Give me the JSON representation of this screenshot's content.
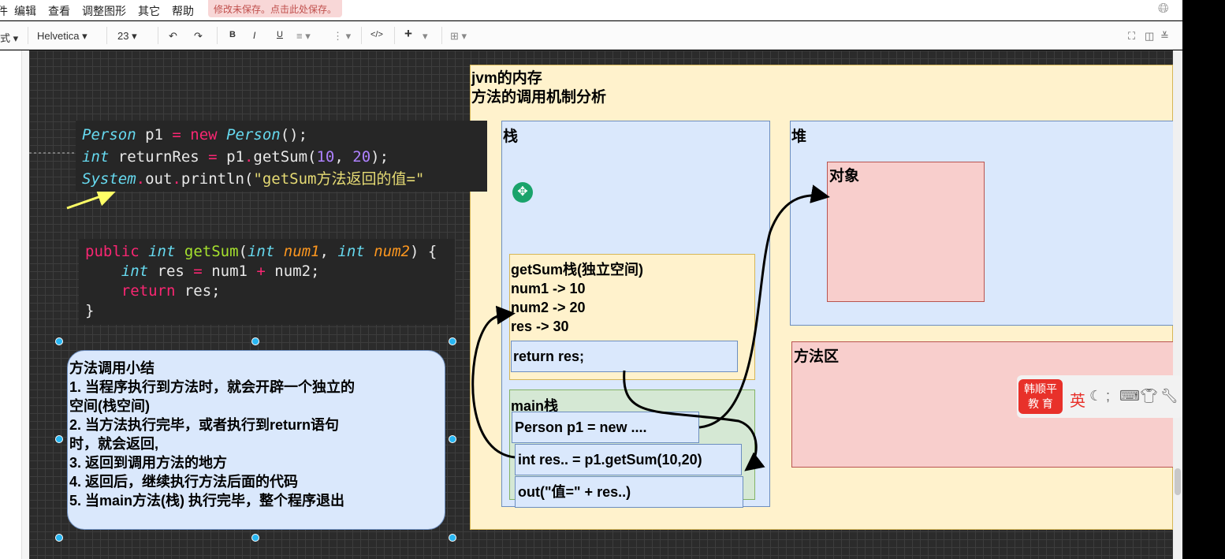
{
  "menu": [
    "编辑",
    "查看",
    "调整图形",
    "其它",
    "帮助"
  ],
  "unsaved_notice": "修改未保存。点击此处保存。",
  "toolbar": {
    "style_label": "式",
    "font": "Helvetica",
    "font_size": "23"
  },
  "diagram": {
    "title_line1": "jvm的内存",
    "title_line2": "方法的调用机制分析",
    "stack_label": "栈",
    "heap_label": "堆",
    "object_label": "对象",
    "method_area_label": "方法区",
    "getsum_stack": {
      "title": "getSum栈(独立空间)",
      "lines": [
        "num1 -> 10",
        "num2 -> 20",
        "res -> 30"
      ],
      "return": "return res;"
    },
    "main_stack": {
      "title": "main栈",
      "frames": [
        "Person p1 = new ....",
        "int res.. = p1.getSum(10,20)",
        "out(\"值=\" + res..)"
      ]
    }
  },
  "code1": {
    "l1": [
      "Person",
      " p1 ",
      "=",
      " new ",
      "Person",
      "();"
    ],
    "l2": [
      "int",
      " returnRes ",
      "=",
      " p1",
      ".",
      "getSum(",
      "10",
      ", ",
      "20",
      ");"
    ],
    "l3": [
      "System",
      ".",
      "out",
      ".",
      "println(",
      "\"getSum方法返回的值=\""
    ]
  },
  "code2": {
    "l1": [
      "public",
      " ",
      "int",
      " ",
      "getSum",
      "(",
      "int",
      " ",
      "num1",
      ", ",
      "int",
      " ",
      "num2",
      ") {"
    ],
    "l2": [
      "    ",
      "int",
      " res ",
      "=",
      " num1 ",
      "+",
      " num2;"
    ],
    "l3": [
      "    ",
      "return",
      " res;"
    ],
    "l4": "}"
  },
  "summary": {
    "title": "方法调用小结",
    "lines": [
      "1. 当程序执行到方法时，就会开辟一个独立的",
      "空间(栈空间)",
      "2. 当方法执行完毕，或者执行到return语句",
      "时，就会返回,",
      "3. 返回到调用方法的地方",
      "4. 返回后，继续执行方法后面的代码",
      "5. 当main方法(栈) 执行完毕，整个程序退出"
    ]
  },
  "ime": {
    "logo": "韩顺平教育",
    "logo_l1": "韩顺平",
    "logo_l2": "教 育",
    "lang": "英",
    "punct": ";"
  }
}
